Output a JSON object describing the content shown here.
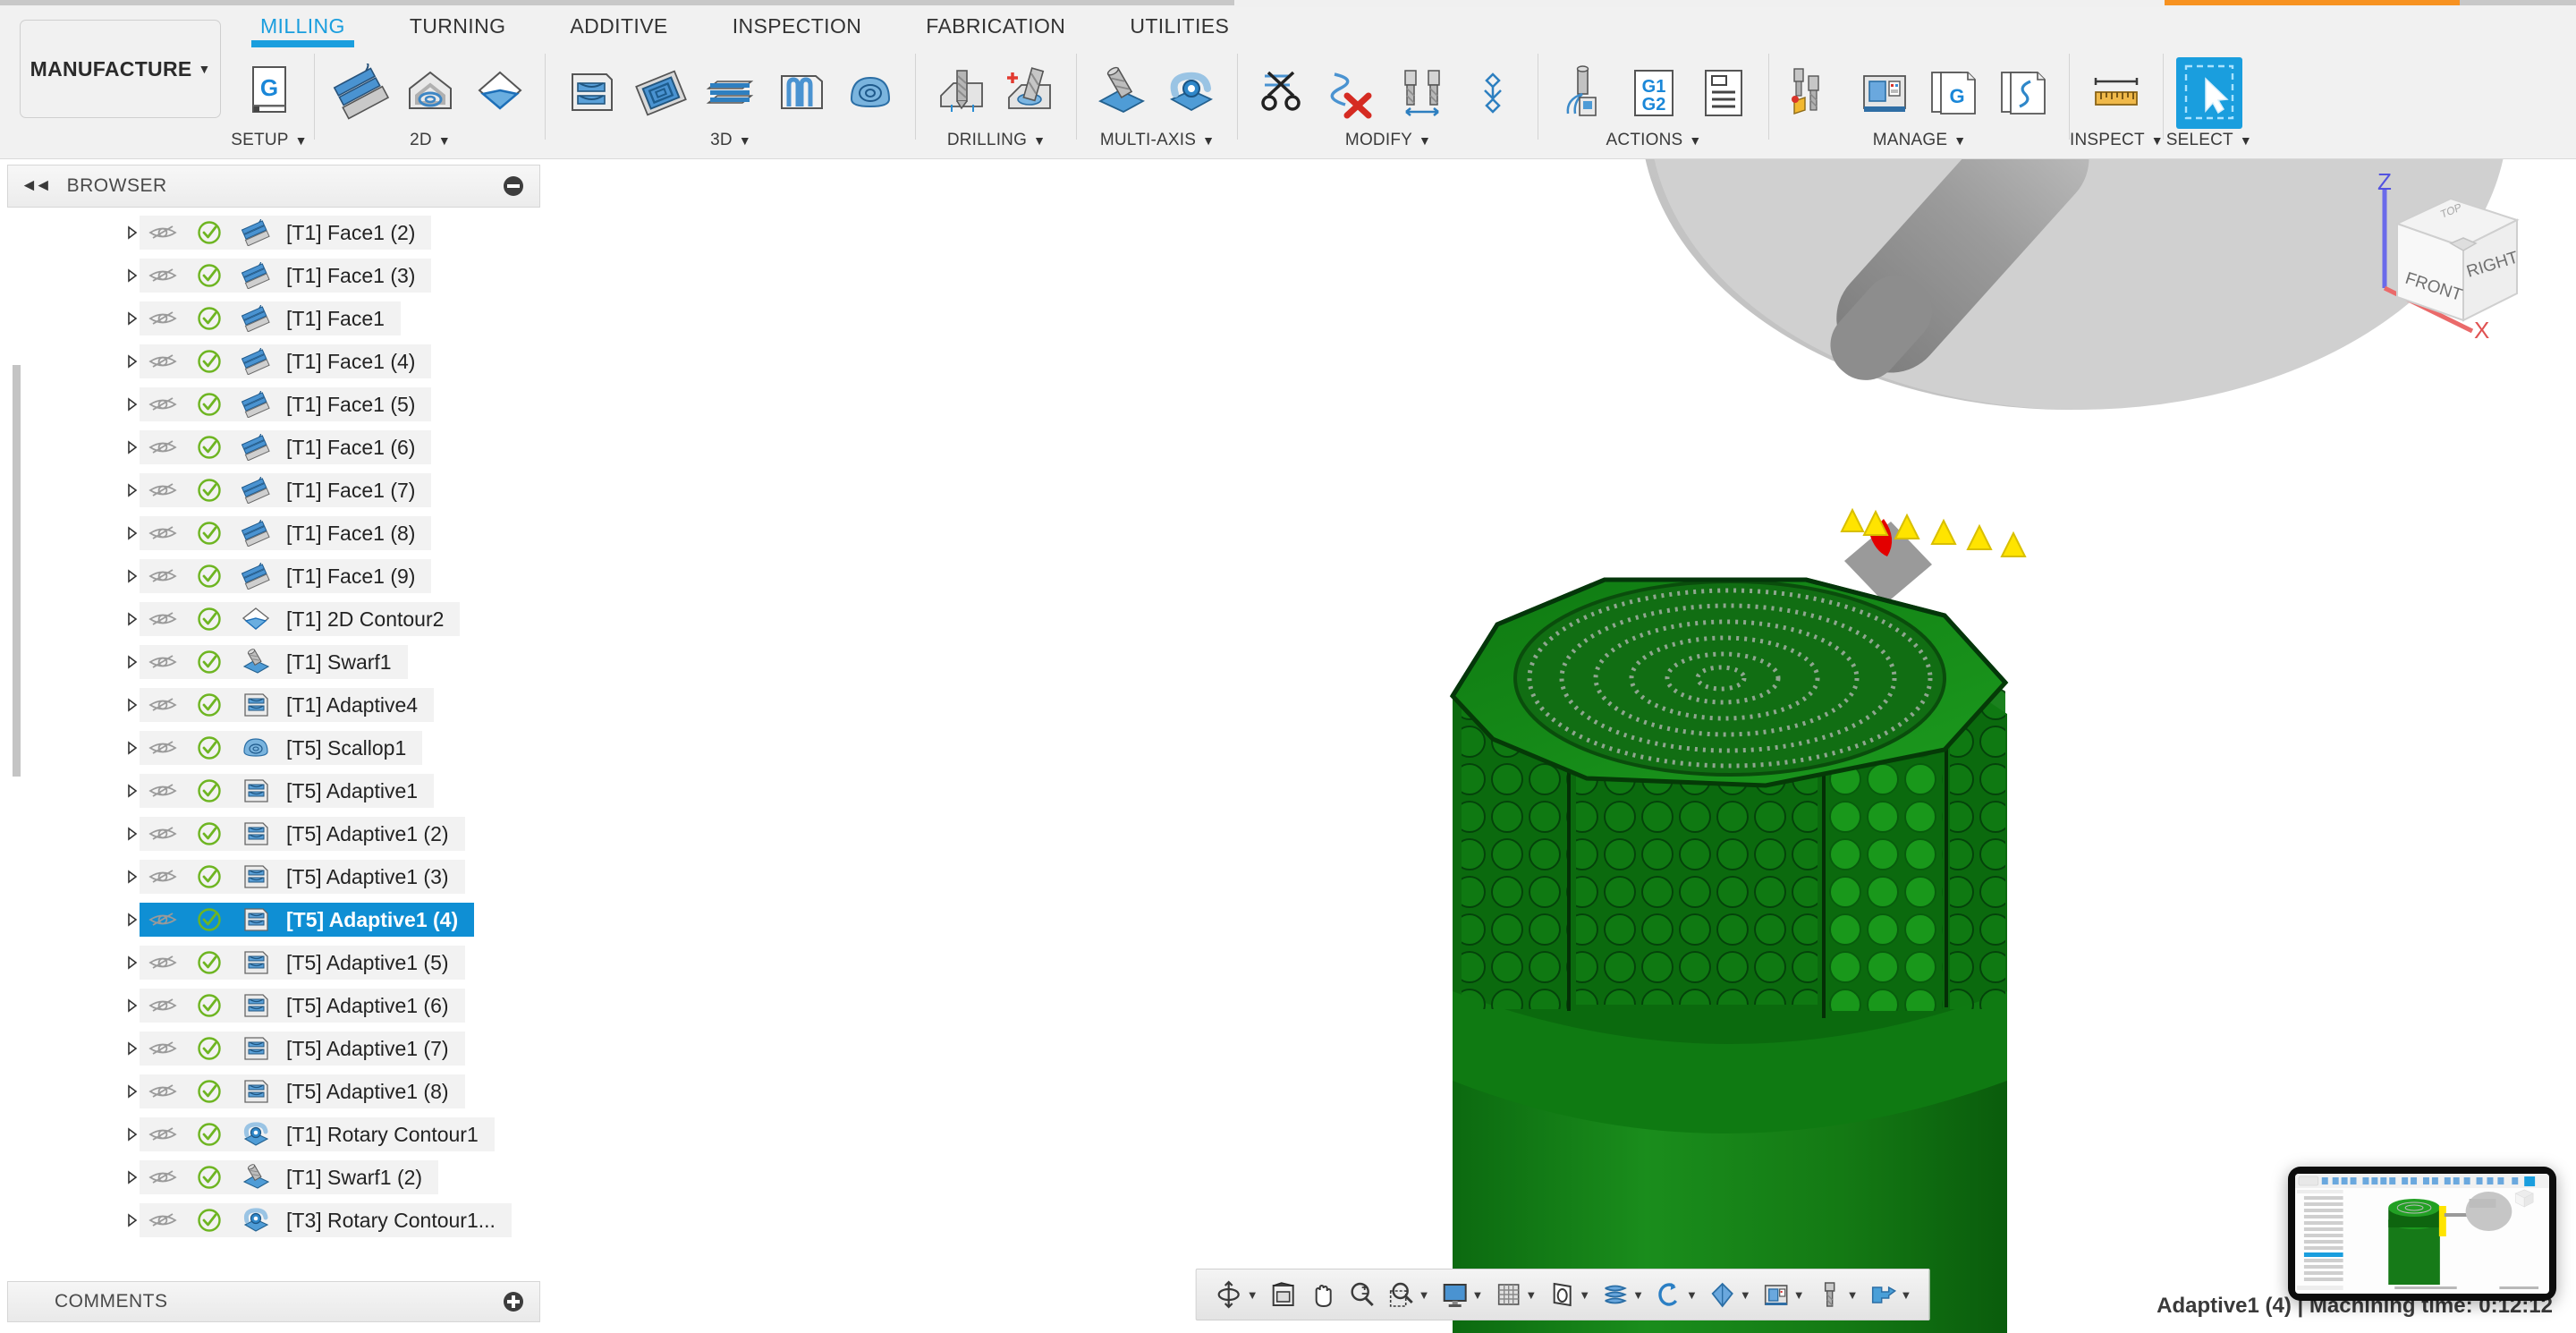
{
  "app": {
    "workspace_label": "MANUFACTURE",
    "tabs": [
      {
        "label": "MILLING",
        "active": true
      },
      {
        "label": "TURNING",
        "active": false
      },
      {
        "label": "ADDITIVE",
        "active": false
      },
      {
        "label": "INSPECTION",
        "active": false
      },
      {
        "label": "FABRICATION",
        "active": false
      },
      {
        "label": "UTILITIES",
        "active": false
      }
    ]
  },
  "ribbon": {
    "groups": [
      {
        "label": "SETUP",
        "icons": [
          "setup-g-icon"
        ]
      },
      {
        "label": "2D",
        "icons": [
          "face-icon",
          "pocket-2d-icon",
          "contour-2d-icon"
        ]
      },
      {
        "label": "3D",
        "icons": [
          "adaptive-3d-icon",
          "pocket-3d-icon",
          "parallel-icon",
          "contour-3d-icon",
          "scallop-icon"
        ]
      },
      {
        "label": "DRILLING",
        "icons": [
          "drill-icon",
          "bore-icon"
        ]
      },
      {
        "label": "MULTI-AXIS",
        "icons": [
          "swarf-icon",
          "rotary-icon"
        ]
      },
      {
        "label": "MODIFY",
        "icons": [
          "trim-icon",
          "delete-toolpath-icon",
          "tool-change-icon",
          "manual-ncprobe-icon"
        ]
      },
      {
        "label": "ACTIONS",
        "icons": [
          "simulate-icon",
          "g1g2-post-icon",
          "setup-sheet-icon"
        ]
      },
      {
        "label": "MANAGE",
        "icons": [
          "tool-library-icon",
          "machine-library-icon",
          "post-library-icon",
          "template-library-icon"
        ]
      },
      {
        "label": "INSPECT",
        "icons": [
          "measure-icon"
        ]
      },
      {
        "label": "SELECT",
        "icons": [
          "select-cursor-icon"
        ]
      }
    ]
  },
  "browser": {
    "title": "BROWSER",
    "collapse_icon": "collapse-left-icon",
    "minimize_icon": "minus-circle-icon",
    "items": [
      {
        "label": "[T1] Face1 (2)",
        "icon": "face-op-icon",
        "visible_off": true,
        "valid": true,
        "selected": false
      },
      {
        "label": "[T1] Face1 (3)",
        "icon": "face-op-icon",
        "visible_off": true,
        "valid": true,
        "selected": false
      },
      {
        "label": "[T1] Face1",
        "icon": "face-op-icon",
        "visible_off": true,
        "valid": true,
        "selected": false
      },
      {
        "label": "[T1] Face1 (4)",
        "icon": "face-op-icon",
        "visible_off": true,
        "valid": true,
        "selected": false
      },
      {
        "label": "[T1] Face1 (5)",
        "icon": "face-op-icon",
        "visible_off": true,
        "valid": true,
        "selected": false
      },
      {
        "label": "[T1] Face1 (6)",
        "icon": "face-op-icon",
        "visible_off": true,
        "valid": true,
        "selected": false
      },
      {
        "label": "[T1] Face1 (7)",
        "icon": "face-op-icon",
        "visible_off": true,
        "valid": true,
        "selected": false
      },
      {
        "label": "[T1] Face1 (8)",
        "icon": "face-op-icon",
        "visible_off": true,
        "valid": true,
        "selected": false
      },
      {
        "label": "[T1] Face1 (9)",
        "icon": "face-op-icon",
        "visible_off": true,
        "valid": true,
        "selected": false
      },
      {
        "label": "[T1] 2D Contour2",
        "icon": "contour-op-icon",
        "visible_off": true,
        "valid": true,
        "selected": false
      },
      {
        "label": "[T1] Swarf1",
        "icon": "swarf-op-icon",
        "visible_off": true,
        "valid": true,
        "selected": false
      },
      {
        "label": "[T1] Adaptive4",
        "icon": "adaptive-op-icon",
        "visible_off": true,
        "valid": true,
        "selected": false
      },
      {
        "label": "[T5] Scallop1",
        "icon": "scallop-op-icon",
        "visible_off": true,
        "valid": true,
        "selected": false
      },
      {
        "label": "[T5] Adaptive1",
        "icon": "adaptive-op-icon",
        "visible_off": true,
        "valid": true,
        "selected": false
      },
      {
        "label": "[T5] Adaptive1 (2)",
        "icon": "adaptive-op-icon",
        "visible_off": true,
        "valid": true,
        "selected": false
      },
      {
        "label": "[T5] Adaptive1 (3)",
        "icon": "adaptive-op-icon",
        "visible_off": true,
        "valid": true,
        "selected": false
      },
      {
        "label": "[T5] Adaptive1 (4)",
        "icon": "adaptive-op-icon",
        "visible_off": true,
        "valid": true,
        "selected": true
      },
      {
        "label": "[T5] Adaptive1 (5)",
        "icon": "adaptive-op-icon",
        "visible_off": true,
        "valid": true,
        "selected": false
      },
      {
        "label": "[T5] Adaptive1 (6)",
        "icon": "adaptive-op-icon",
        "visible_off": true,
        "valid": true,
        "selected": false
      },
      {
        "label": "[T5] Adaptive1 (7)",
        "icon": "adaptive-op-icon",
        "visible_off": true,
        "valid": true,
        "selected": false
      },
      {
        "label": "[T5] Adaptive1 (8)",
        "icon": "adaptive-op-icon",
        "visible_off": true,
        "valid": true,
        "selected": false
      },
      {
        "label": "[T1] Rotary Contour1",
        "icon": "rotary-op-icon",
        "visible_off": true,
        "valid": true,
        "selected": false
      },
      {
        "label": "[T1] Swarf1 (2)",
        "icon": "swarf-op-icon",
        "visible_off": true,
        "valid": true,
        "selected": false
      },
      {
        "label": "[T3] Rotary Contour1...",
        "icon": "rotary-op-icon",
        "visible_off": true,
        "valid": true,
        "selected": false
      }
    ]
  },
  "comments": {
    "title": "COMMENTS",
    "add_icon": "plus-circle-icon"
  },
  "viewcube": {
    "front_label": "FRONT",
    "right_label": "RIGHT",
    "top_label": "TOP",
    "axis_z": "Z",
    "axis_x": "X"
  },
  "navbar": {
    "items": [
      {
        "name": "orbit-icon",
        "caret": true
      },
      {
        "name": "look-at-icon",
        "caret": false
      },
      {
        "name": "pan-hand-icon",
        "caret": false
      },
      {
        "name": "zoom-icon",
        "caret": false
      },
      {
        "name": "zoom-window-icon",
        "caret": true
      },
      {
        "name": "display-settings-icon",
        "caret": true
      },
      {
        "name": "grid-snap-icon",
        "caret": true
      },
      {
        "name": "viewports-icon",
        "caret": true
      },
      {
        "name": "stock-visibility-icon",
        "caret": true
      },
      {
        "name": "simulation-loop-icon",
        "caret": true
      },
      {
        "name": "object-visibility-icon",
        "caret": true
      },
      {
        "name": "machine-view-icon",
        "caret": true
      },
      {
        "name": "tool-view-icon",
        "caret": true
      },
      {
        "name": "toolpath-view-icon",
        "caret": true
      }
    ]
  },
  "status": {
    "text": "Adaptive1 (4) | Machining time: 0:12:12",
    "operation": "Adaptive1 (4)",
    "machining_time": "0:12:12"
  },
  "colors": {
    "accent_blue": "#1a9ede",
    "selection_blue": "#0f8fd4",
    "stock_green": "#188b1a",
    "valid_green": "#6eb522",
    "toolpath_yellow": "#ffe500",
    "tool_red": "#e60000",
    "orange_strip": "#f79221"
  }
}
